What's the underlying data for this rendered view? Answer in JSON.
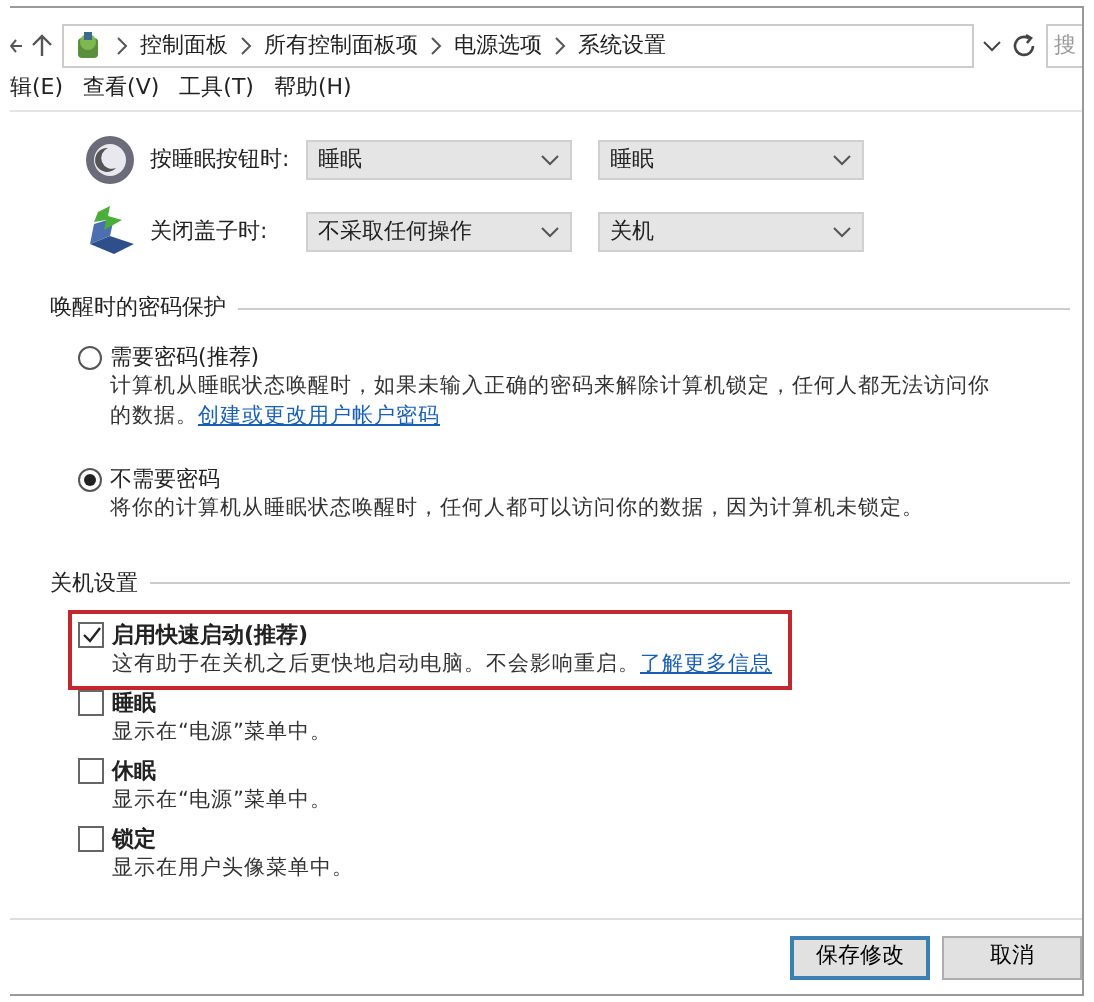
{
  "address_bar": {
    "breadcrumb": [
      "控制面板",
      "所有控制面板项",
      "电源选项",
      "系统设置"
    ],
    "search": {
      "placeholder": "搜"
    }
  },
  "menu": [
    "辑(E)",
    "查看(V)",
    "工具(T)",
    "帮助(H)"
  ],
  "power_actions": [
    {
      "kind": "sleep-button",
      "label": "按睡眠按钮时:",
      "battery": "睡眠",
      "plugged_in": "睡眠"
    },
    {
      "kind": "lid",
      "label": "关闭盖子时:",
      "battery": "不采取任何操作",
      "plugged_in": "关机"
    }
  ],
  "password_section": {
    "title": "唤醒时的密码保护",
    "options": [
      {
        "label": "需要密码(推荐)",
        "description": "计算机从睡眠状态唤醒时，如果未输入正确的密码来解除计算机锁定，任何人都无法访问你的数据。",
        "link": "创建或更改用户帐户密码",
        "selected": false
      },
      {
        "label": "不需要密码",
        "description": "将你的计算机从睡眠状态唤醒时，任何人都可以访问你的数据，因为计算机未锁定。",
        "selected": true
      }
    ]
  },
  "shutdown_section": {
    "title": "关机设置",
    "items": [
      {
        "label": "启用快速启动(推荐)",
        "description": "这有助于在关机之后更快地启动电脑。不会影响重启。",
        "link": "了解更多信息",
        "checked": true,
        "highlighted": true
      },
      {
        "label": "睡眠",
        "description": "显示在“电源”菜单中。",
        "checked": false,
        "highlighted": false
      },
      {
        "label": "休眠",
        "description": "显示在“电源”菜单中。",
        "checked": false,
        "highlighted": false
      },
      {
        "label": "锁定",
        "description": "显示在用户头像菜单中。",
        "checked": false,
        "highlighted": false
      }
    ]
  },
  "buttons": [
    {
      "label": "保存修改",
      "kind": "primary"
    },
    {
      "label": "取消",
      "kind": "default"
    }
  ]
}
